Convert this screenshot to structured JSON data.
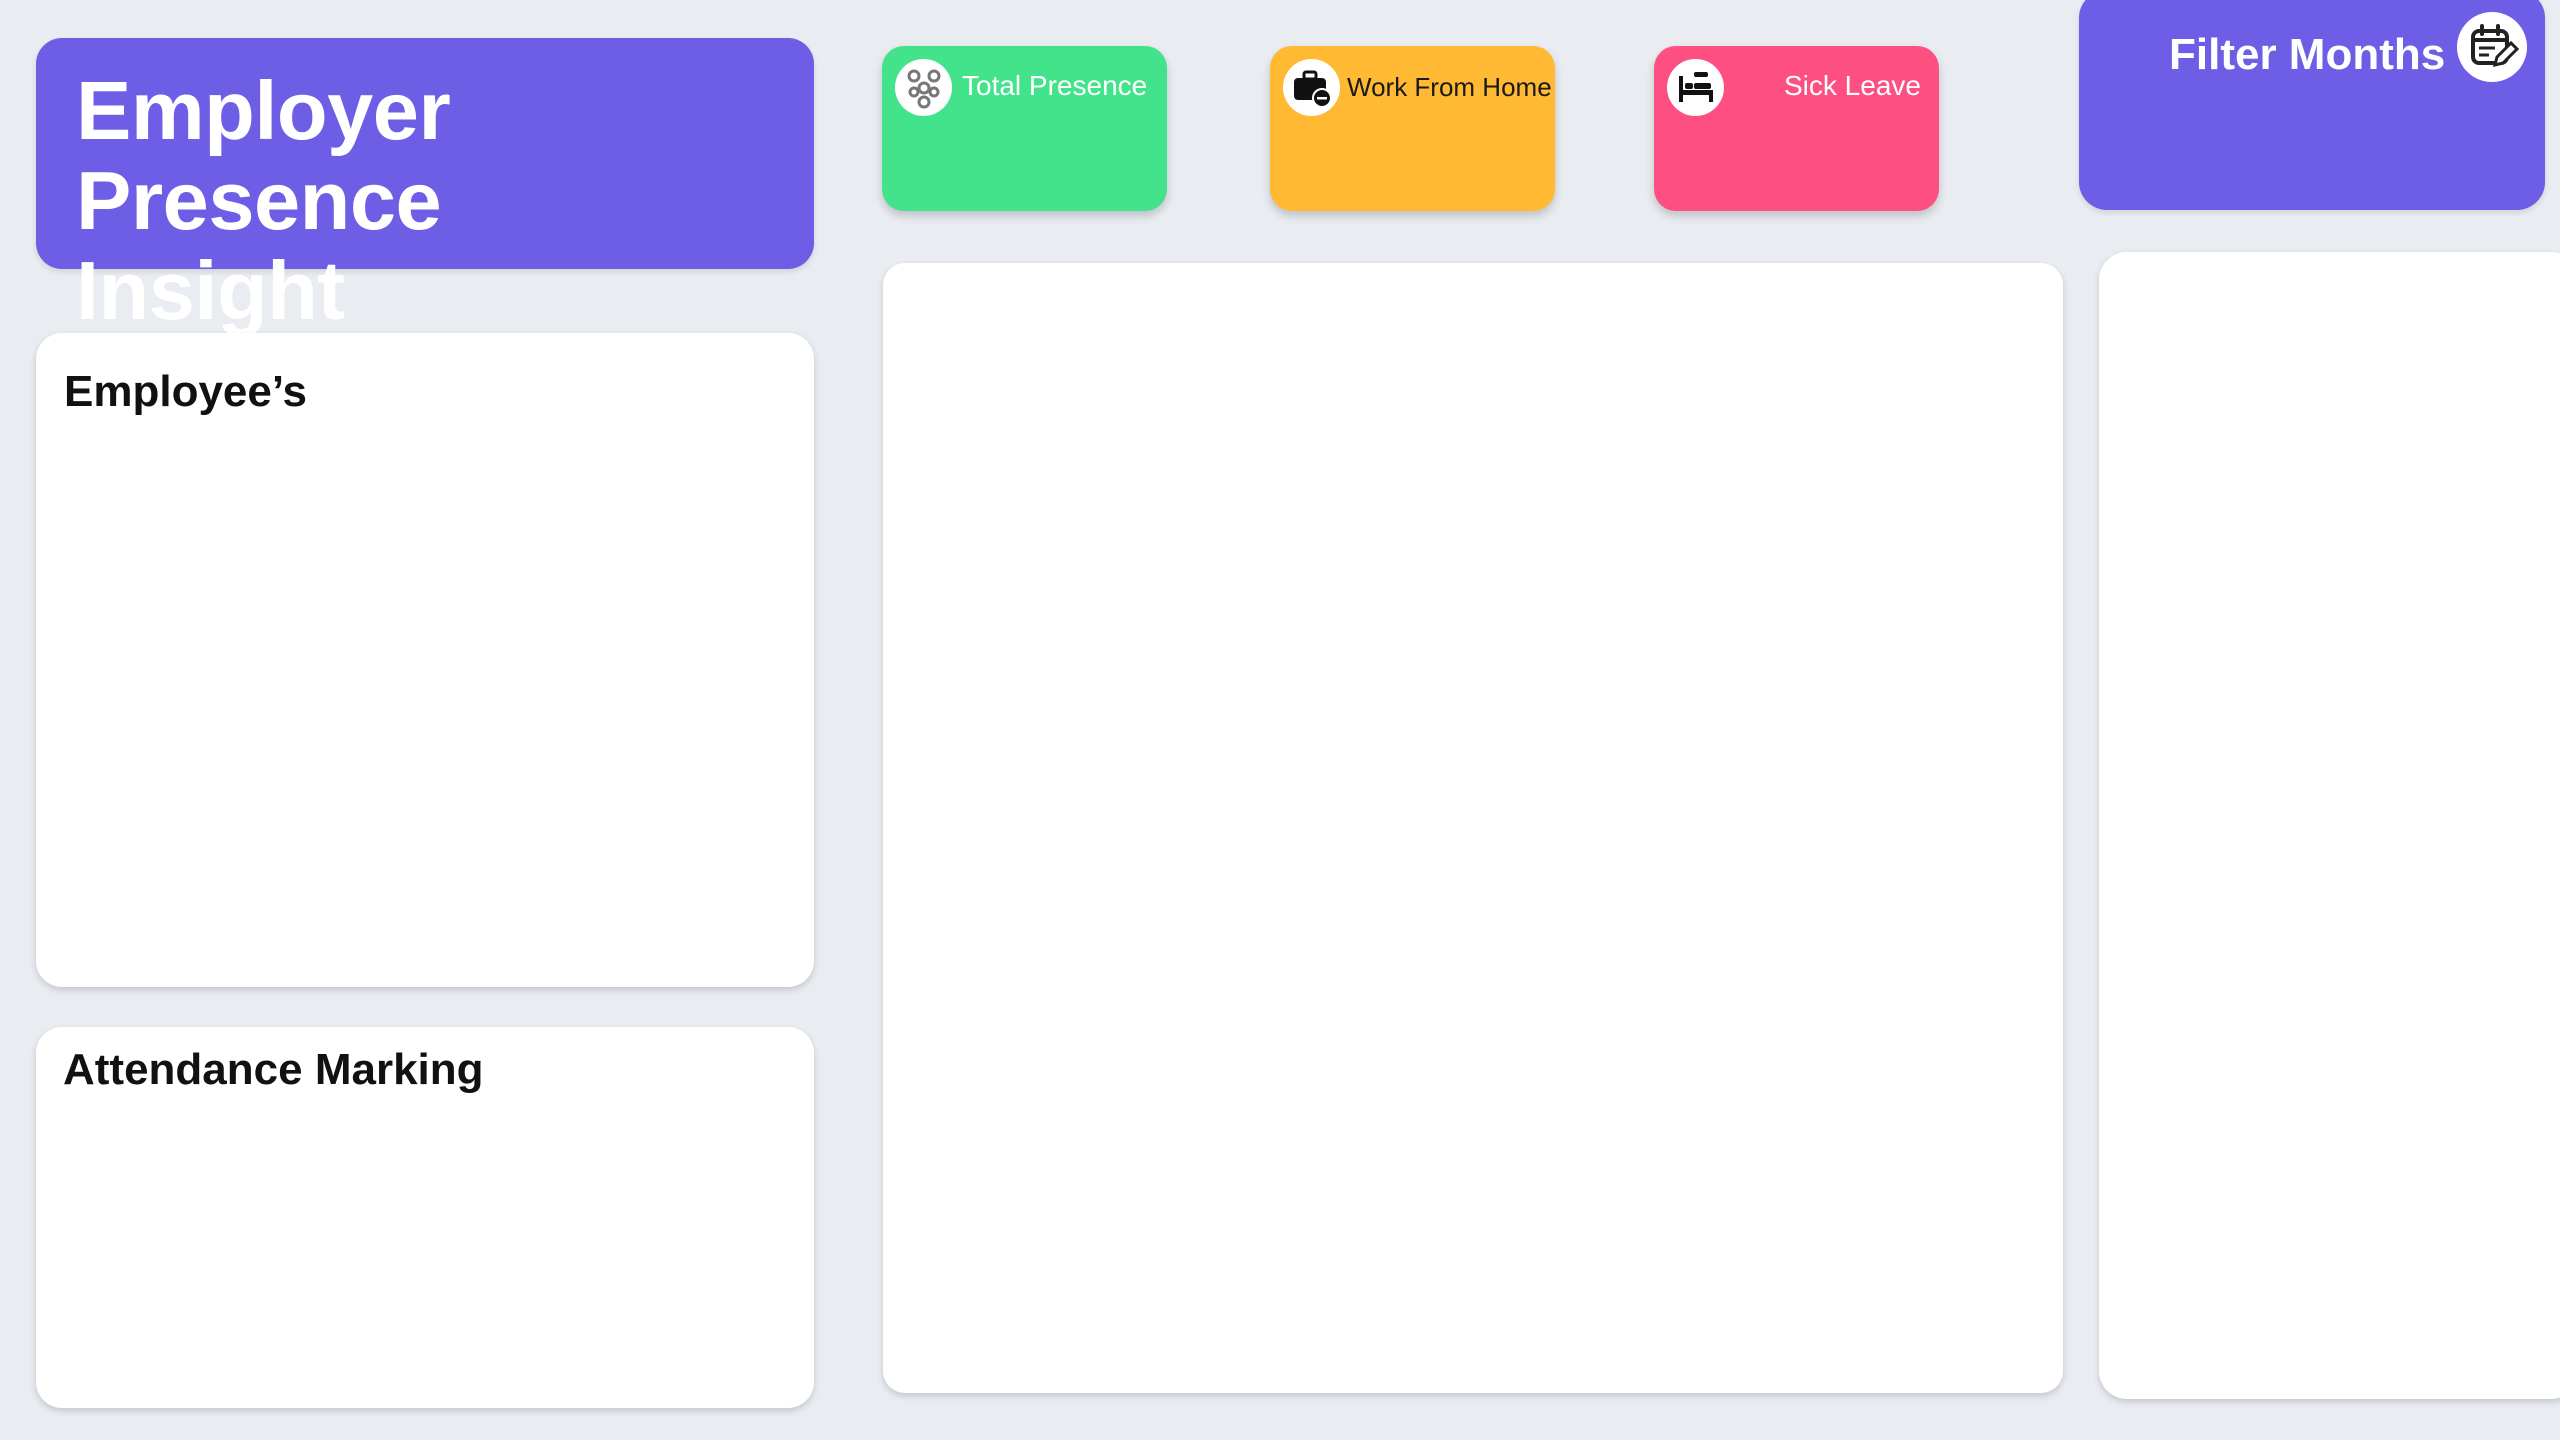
{
  "header": {
    "title_line1": "Employer Presence",
    "title_line2": "Insight"
  },
  "kpis": {
    "total_presence": {
      "label": "Total Presence",
      "icon": "people-group-icon",
      "color": "#42e38b"
    },
    "work_from_home": {
      "label": "Work From Home",
      "icon": "briefcase-icon",
      "color": "#ffb932"
    },
    "sick_leave": {
      "label": "Sick Leave",
      "icon": "bed-icon",
      "color": "#fe4f82"
    }
  },
  "filter": {
    "label": "Filter Months",
    "icon": "calendar-edit-icon"
  },
  "panels": {
    "employees_title": "Employee’s",
    "attendance_title": "Attendance Marking"
  },
  "colors": {
    "brand": "#6e5ee6",
    "background": "#e9ecf1"
  }
}
